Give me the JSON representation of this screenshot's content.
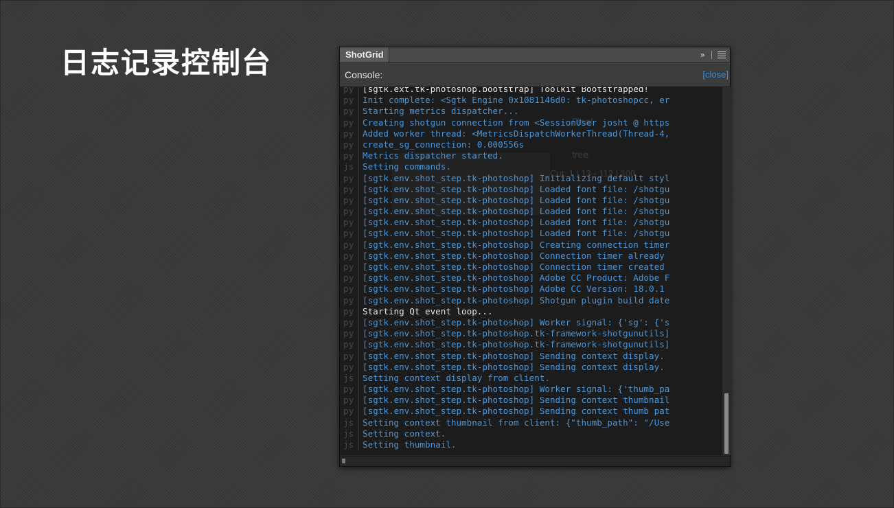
{
  "slide": {
    "title": "日志记录控制台"
  },
  "panel": {
    "tab_label": "ShotGrid",
    "expand_icon": "»",
    "console_label": "Console:",
    "close_label": "[close]"
  },
  "background_ghost": {
    "status": "Final",
    "tree": "tree",
    "cut": "Cut: 1 | 13 - 112 | 100"
  },
  "colors": {
    "log_blue": "#4a95d8",
    "log_white": "#e6e6e6",
    "accent_link": "#3b8fd6"
  },
  "log": [
    {
      "src": "py",
      "color": "white",
      "text": "[sgtk.ext.tk-photoshop.bootstrap] Toolkit Bootstrapped!"
    },
    {
      "src": "py",
      "color": "blue",
      "text": "Init complete: <Sgtk Engine 0x1081146d0: tk-photoshopcc, er"
    },
    {
      "src": "py",
      "color": "blue",
      "text": "Starting metrics dispatcher..."
    },
    {
      "src": "py",
      "color": "blue",
      "text": "Creating shotgun connection from <SessionUser josht @ https"
    },
    {
      "src": "py",
      "color": "blue",
      "text": "Added worker thread: <MetricsDispatchWorkerThread(Thread-4,"
    },
    {
      "src": "py",
      "color": "blue",
      "text": "create_sg_connection: 0.000556s"
    },
    {
      "src": "py",
      "color": "blue",
      "text": "Metrics dispatcher started."
    },
    {
      "src": "js",
      "color": "blue",
      "text": "Setting commands."
    },
    {
      "src": "py",
      "color": "blue",
      "text": "[sgtk.env.shot_step.tk-photoshop] Initializing default styl"
    },
    {
      "src": "py",
      "color": "blue",
      "text": "[sgtk.env.shot_step.tk-photoshop] Loaded font file: /shotgu"
    },
    {
      "src": "py",
      "color": "blue",
      "text": "[sgtk.env.shot_step.tk-photoshop] Loaded font file: /shotgu"
    },
    {
      "src": "py",
      "color": "blue",
      "text": "[sgtk.env.shot_step.tk-photoshop] Loaded font file: /shotgu"
    },
    {
      "src": "py",
      "color": "blue",
      "text": "[sgtk.env.shot_step.tk-photoshop] Loaded font file: /shotgu"
    },
    {
      "src": "py",
      "color": "blue",
      "text": "[sgtk.env.shot_step.tk-photoshop] Loaded font file: /shotgu"
    },
    {
      "src": "py",
      "color": "blue",
      "text": "[sgtk.env.shot_step.tk-photoshop] Creating connection timer"
    },
    {
      "src": "py",
      "color": "blue",
      "text": "[sgtk.env.shot_step.tk-photoshop] Connection timer already"
    },
    {
      "src": "py",
      "color": "blue",
      "text": "[sgtk.env.shot_step.tk-photoshop] Connection timer created"
    },
    {
      "src": "py",
      "color": "blue",
      "text": "[sgtk.env.shot_step.tk-photoshop] Adobe CC Product: Adobe F"
    },
    {
      "src": "py",
      "color": "blue",
      "text": "[sgtk.env.shot_step.tk-photoshop] Adobe CC Version: 18.0.1"
    },
    {
      "src": "py",
      "color": "blue",
      "text": "[sgtk.env.shot_step.tk-photoshop] Shotgun plugin build date"
    },
    {
      "src": "py",
      "color": "white",
      "text": "Starting Qt event loop..."
    },
    {
      "src": "py",
      "color": "blue",
      "text": "[sgtk.env.shot_step.tk-photoshop] Worker signal: {'sg': {'s"
    },
    {
      "src": "py",
      "color": "blue",
      "text": "[sgtk.env.shot_step.tk-photoshop.tk-framework-shotgunutils]"
    },
    {
      "src": "py",
      "color": "blue",
      "text": "[sgtk.env.shot_step.tk-photoshop.tk-framework-shotgunutils]"
    },
    {
      "src": "py",
      "color": "blue",
      "text": "[sgtk.env.shot_step.tk-photoshop] Sending context display."
    },
    {
      "src": "py",
      "color": "blue",
      "text": "[sgtk.env.shot_step.tk-photoshop] Sending context display."
    },
    {
      "src": "js",
      "color": "blue",
      "text": "Setting context display from client."
    },
    {
      "src": "py",
      "color": "blue",
      "text": "[sgtk.env.shot_step.tk-photoshop] Worker signal: {'thumb_pa"
    },
    {
      "src": "py",
      "color": "blue",
      "text": "[sgtk.env.shot_step.tk-photoshop] Sending context thumbnail"
    },
    {
      "src": "py",
      "color": "blue",
      "text": "[sgtk.env.shot_step.tk-photoshop] Sending context thumb pat"
    },
    {
      "src": "js",
      "color": "blue",
      "text": "Setting context thumbnail from client: {\"thumb_path\": \"/Use"
    },
    {
      "src": "js",
      "color": "blue",
      "text": "Setting context."
    },
    {
      "src": "js",
      "color": "blue",
      "text": "Setting thumbnail."
    }
  ]
}
